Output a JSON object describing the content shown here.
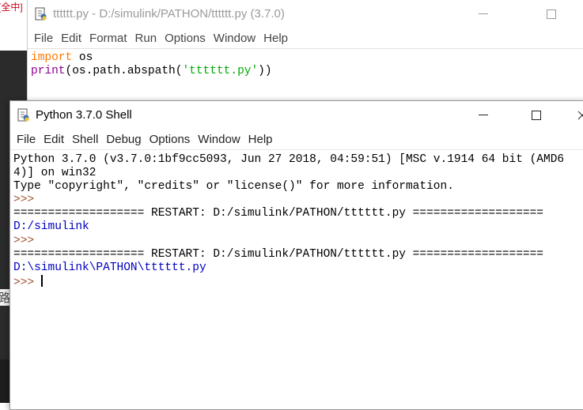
{
  "background": {
    "edge_text_top": "[全中]",
    "edge_text_mid": "路径"
  },
  "editor": {
    "title": "tttttt.py - D:/simulink/PATHON/tttttt.py (3.7.0)",
    "menus": [
      "File",
      "Edit",
      "Format",
      "Run",
      "Options",
      "Window",
      "Help"
    ],
    "code": {
      "line1": {
        "keyword": "import",
        "rest": " os"
      },
      "line2": {
        "builtin": "print",
        "pre": "(os.path.abspath(",
        "string": "'tttttt.py'",
        "post": "))"
      }
    }
  },
  "shell": {
    "title": "Python 3.7.0 Shell",
    "menus": [
      "File",
      "Edit",
      "Shell",
      "Debug",
      "Options",
      "Window",
      "Help"
    ],
    "lines": {
      "banner1": "Python 3.7.0 (v3.7.0:1bf9cc5093, Jun 27 2018, 04:59:51) [MSC v.1914 64 bit (AMD6",
      "banner2": "4)] on win32",
      "banner3": "Type \"copyright\", \"credits\" or \"license()\" for more information.",
      "prompt": ">>>",
      "restart1": "=================== RESTART: D:/simulink/PATHON/tttttt.py ===================",
      "output1": "D:/simulink",
      "restart2": "=================== RESTART: D:/simulink/PATHON/tttttt.py ===================",
      "output2": "D:\\simulink\\PATHON\\tttttt.py"
    }
  },
  "colors": {
    "keyword": "#ff7700",
    "builtin": "#900090",
    "string": "#00aa00",
    "output": "#0000c0",
    "prompt": "#a0522d"
  }
}
